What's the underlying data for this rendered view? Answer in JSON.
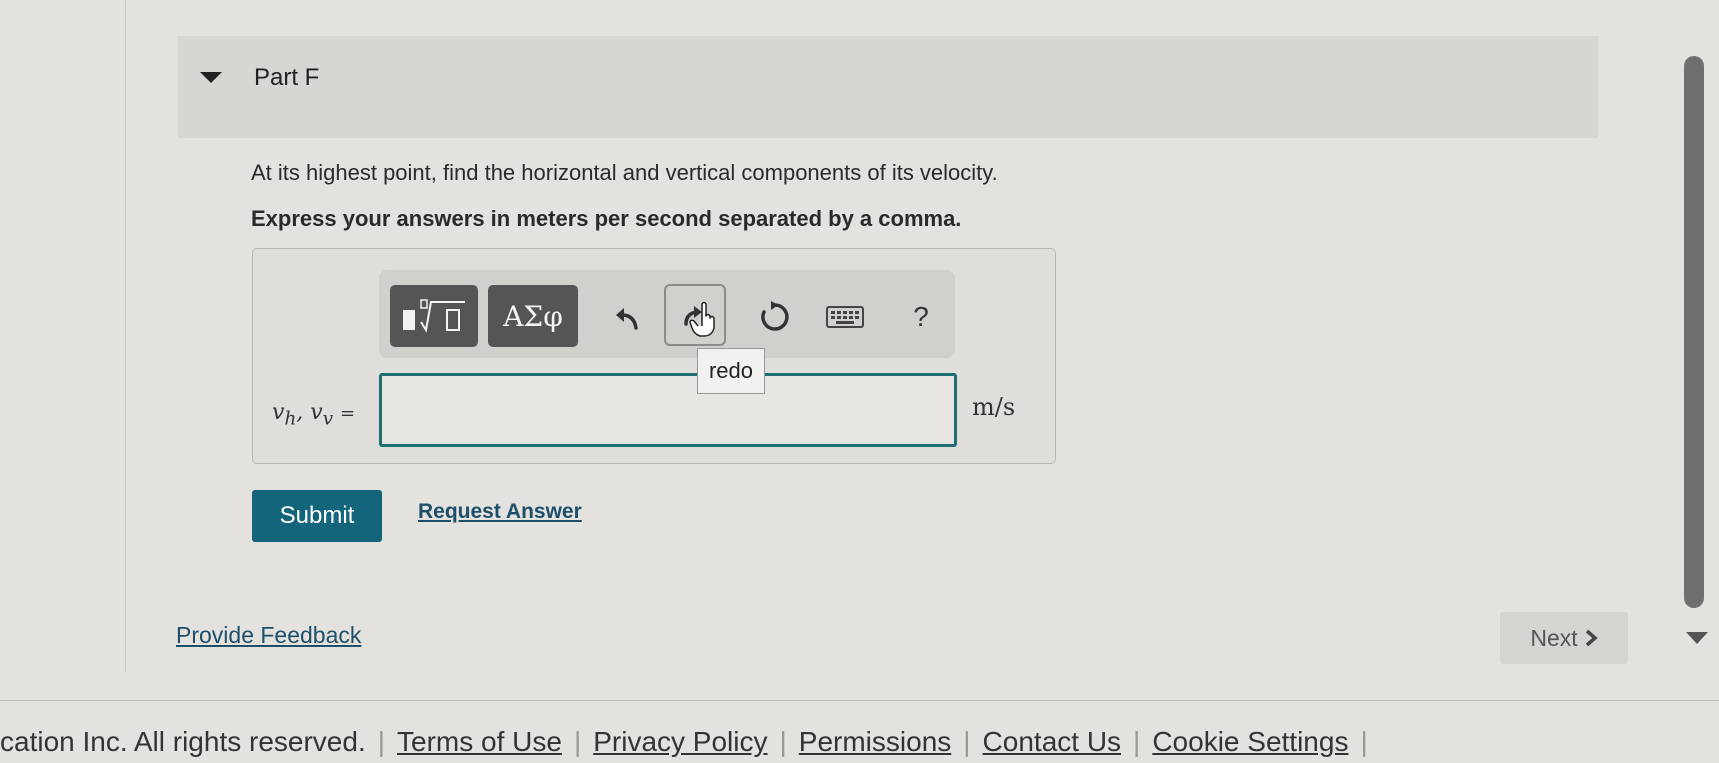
{
  "part": {
    "title": "Part F"
  },
  "question": {
    "text": "At its highest point, find the horizontal and vertical components of its velocity.",
    "instruction": "Express your answers in meters per second separated by a comma."
  },
  "toolbar": {
    "greek_label": "ΑΣφ",
    "help_label": "?",
    "tooltip": "redo"
  },
  "answer": {
    "var_vh": "v",
    "sub_h": "h",
    "var_vv": "v",
    "sub_v": "v",
    "equals": "=",
    "value": "",
    "unit": "m/s"
  },
  "actions": {
    "submit_label": "Submit",
    "request_label": "Request Answer",
    "feedback_label": "Provide Feedback",
    "next_label": "Next"
  },
  "footer": {
    "copyright": "cation Inc. All rights reserved.",
    "links": [
      "Terms of Use",
      "Privacy Policy",
      "Permissions",
      "Contact Us",
      "Cookie Settings"
    ]
  },
  "colors": {
    "accent": "#12657a",
    "input_border": "#1f6f73",
    "toolbar_button": "#555555"
  }
}
